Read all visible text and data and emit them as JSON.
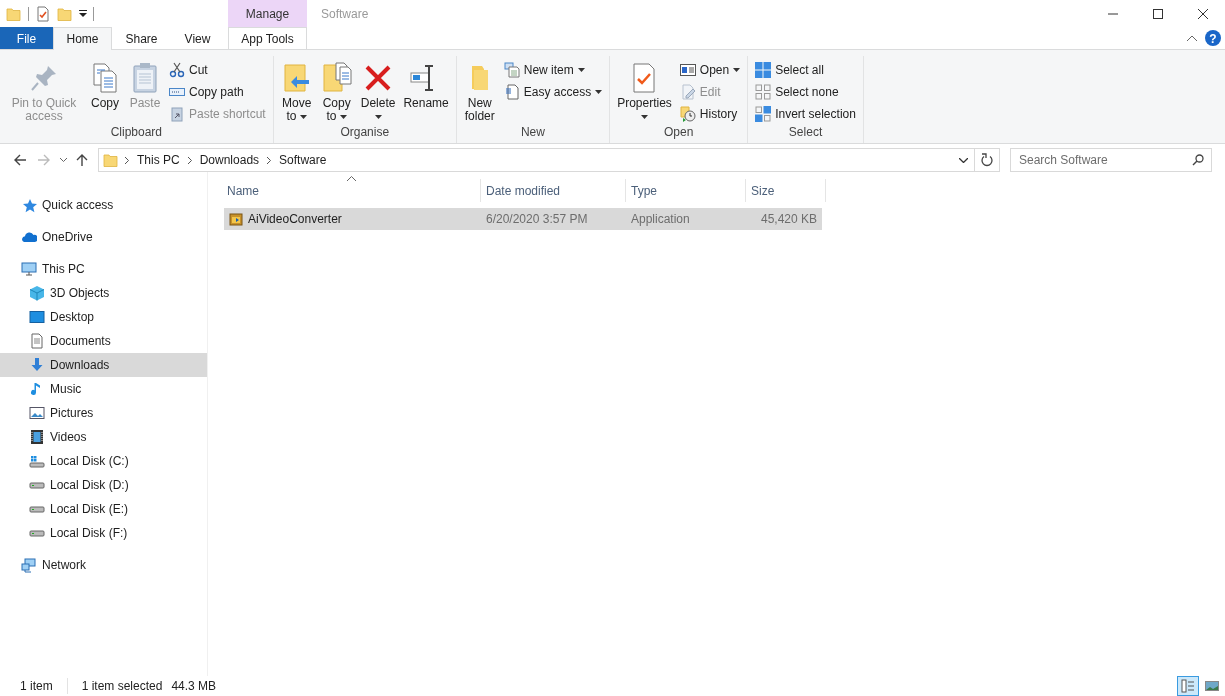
{
  "window": {
    "title": "Software",
    "contextual_header": "Manage"
  },
  "ribbon_tabs": [
    {
      "label": "File",
      "kind": "file",
      "selected": false
    },
    {
      "label": "Home",
      "kind": "normal",
      "selected": true
    },
    {
      "label": "Share",
      "kind": "normal",
      "selected": false
    },
    {
      "label": "View",
      "kind": "normal",
      "selected": false
    },
    {
      "label": "App Tools",
      "kind": "contextual",
      "selected": false
    }
  ],
  "ribbon_groups": [
    {
      "label": "Clipboard",
      "items": [
        {
          "label": "Pin to Quick access",
          "kind": "large",
          "disabled": true,
          "dropdown": false
        },
        {
          "label": "Copy",
          "kind": "large",
          "disabled": false,
          "dropdown": false
        },
        {
          "label": "Paste",
          "kind": "large",
          "disabled": true,
          "dropdown": false
        },
        {
          "label": "Cut",
          "kind": "small",
          "disabled": false,
          "dropdown": false
        },
        {
          "label": "Copy path",
          "kind": "small",
          "disabled": false,
          "dropdown": false
        },
        {
          "label": "Paste shortcut",
          "kind": "small",
          "disabled": true,
          "dropdown": false
        }
      ]
    },
    {
      "label": "Organise",
      "items": [
        {
          "label": "Move to",
          "kind": "large",
          "disabled": false,
          "dropdown": true
        },
        {
          "label": "Copy to",
          "kind": "large",
          "disabled": false,
          "dropdown": true
        },
        {
          "label": "Delete",
          "kind": "large",
          "disabled": false,
          "dropdown": true
        },
        {
          "label": "Rename",
          "kind": "large",
          "disabled": false,
          "dropdown": false
        }
      ]
    },
    {
      "label": "New",
      "items": [
        {
          "label": "New folder",
          "kind": "large",
          "disabled": false,
          "dropdown": false
        },
        {
          "label": "New item",
          "kind": "small",
          "disabled": false,
          "dropdown": true
        },
        {
          "label": "Easy access",
          "kind": "small",
          "disabled": false,
          "dropdown": true
        }
      ]
    },
    {
      "label": "Open",
      "items": [
        {
          "label": "Properties",
          "kind": "large",
          "disabled": false,
          "dropdown": true
        },
        {
          "label": "Open",
          "kind": "small",
          "disabled": false,
          "dropdown": true
        },
        {
          "label": "Edit",
          "kind": "small",
          "disabled": true,
          "dropdown": false
        },
        {
          "label": "History",
          "kind": "small",
          "disabled": false,
          "dropdown": false
        }
      ]
    },
    {
      "label": "Select",
      "items": [
        {
          "label": "Select all",
          "kind": "small",
          "disabled": false,
          "dropdown": false
        },
        {
          "label": "Select none",
          "kind": "small",
          "disabled": false,
          "dropdown": false
        },
        {
          "label": "Invert selection",
          "kind": "small",
          "disabled": false,
          "dropdown": false
        }
      ]
    }
  ],
  "help_button": {
    "label": "?"
  },
  "address_bar": {
    "breadcrumbs": [
      "This PC",
      "Downloads",
      "Software"
    ]
  },
  "search": {
    "placeholder": "Search Software"
  },
  "navigation": [
    {
      "label": "Quick access",
      "kind": "star",
      "selected": false
    },
    {
      "label": "OneDrive",
      "kind": "cloud",
      "selected": false
    },
    {
      "label": "This PC",
      "kind": "pc",
      "selected": false,
      "children": [
        {
          "label": "3D Objects",
          "kind": "cube",
          "selected": false
        },
        {
          "label": "Desktop",
          "kind": "desktop",
          "selected": false
        },
        {
          "label": "Documents",
          "kind": "documents",
          "selected": false
        },
        {
          "label": "Downloads",
          "kind": "downloads",
          "selected": true
        },
        {
          "label": "Music",
          "kind": "music",
          "selected": false
        },
        {
          "label": "Pictures",
          "kind": "pictures",
          "selected": false
        },
        {
          "label": "Videos",
          "kind": "videos",
          "selected": false
        },
        {
          "label": "Local Disk (C:)",
          "kind": "system_drive",
          "selected": false
        },
        {
          "label": "Local Disk (D:)",
          "kind": "drive",
          "selected": false
        },
        {
          "label": "Local Disk (E:)",
          "kind": "drive",
          "selected": false
        },
        {
          "label": "Local Disk (F:)",
          "kind": "drive",
          "selected": false
        }
      ]
    },
    {
      "label": "Network",
      "kind": "network",
      "selected": false
    }
  ],
  "file_list": {
    "columns": [
      {
        "label": "Name",
        "sorted": true
      },
      {
        "label": "Date modified",
        "sorted": false
      },
      {
        "label": "Type",
        "sorted": false
      },
      {
        "label": "Size",
        "sorted": false
      }
    ],
    "rows": [
      {
        "cells": [
          "AiVideoConverter",
          "6/20/2020 3:57 PM",
          "Application",
          "45,420 KB"
        ],
        "selected": true
      }
    ]
  },
  "status_bar": {
    "item_count": "1 item",
    "selection": "1 item selected",
    "selection_size": "44.3 MB"
  },
  "view_buttons": [
    {
      "kind": "details",
      "selected": true
    },
    {
      "kind": "large_icons",
      "selected": false
    }
  ]
}
